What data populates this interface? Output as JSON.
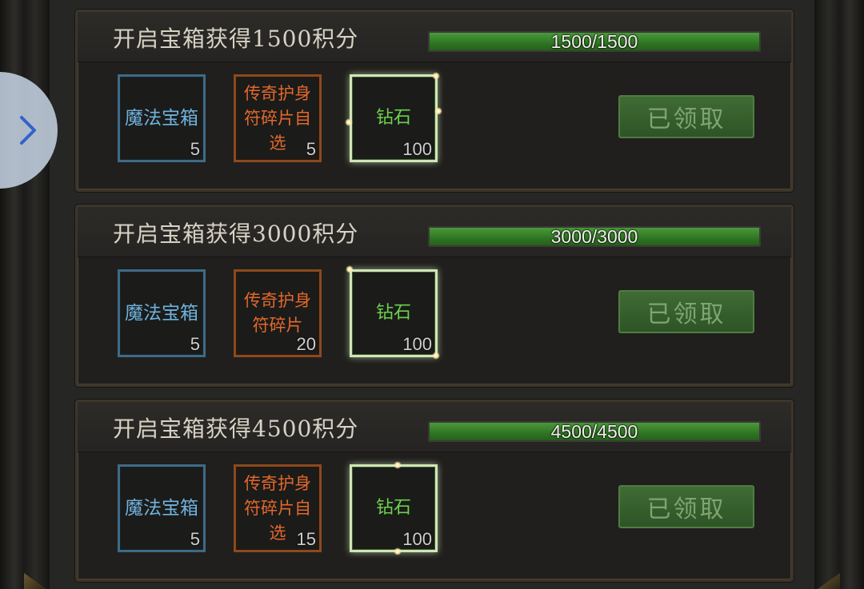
{
  "rewards": [
    {
      "title": "开启宝箱获得1500积分",
      "progress_text": "1500/1500",
      "progress_fraction": 1.0,
      "items": [
        {
          "name": "魔法宝箱",
          "count": "5",
          "rarity": "blue"
        },
        {
          "name": "传奇护身符碎片自选",
          "count": "5",
          "rarity": "orange"
        },
        {
          "name": "钻石",
          "count": "100",
          "rarity": "green"
        }
      ],
      "button_label": "已领取"
    },
    {
      "title": "开启宝箱获得3000积分",
      "progress_text": "3000/3000",
      "progress_fraction": 1.0,
      "items": [
        {
          "name": "魔法宝箱",
          "count": "5",
          "rarity": "blue"
        },
        {
          "name": "传奇护身符碎片",
          "count": "20",
          "rarity": "orange"
        },
        {
          "name": "钻石",
          "count": "100",
          "rarity": "green"
        }
      ],
      "button_label": "已领取"
    },
    {
      "title": "开启宝箱获得4500积分",
      "progress_text": "4500/4500",
      "progress_fraction": 1.0,
      "items": [
        {
          "name": "魔法宝箱",
          "count": "5",
          "rarity": "blue"
        },
        {
          "name": "传奇护身符碎片自选",
          "count": "15",
          "rarity": "orange"
        },
        {
          "name": "钻石",
          "count": "100",
          "rarity": "green"
        }
      ],
      "button_label": "已领取"
    }
  ],
  "nav": {
    "icon": "chevron-right-icon"
  },
  "colors": {
    "progress_fill": "#2f7423",
    "rarity_blue": "#3f6a86",
    "rarity_orange": "#8a4a1f",
    "rarity_green": "#cfe6b8",
    "claim_button": "#3f6b34"
  }
}
